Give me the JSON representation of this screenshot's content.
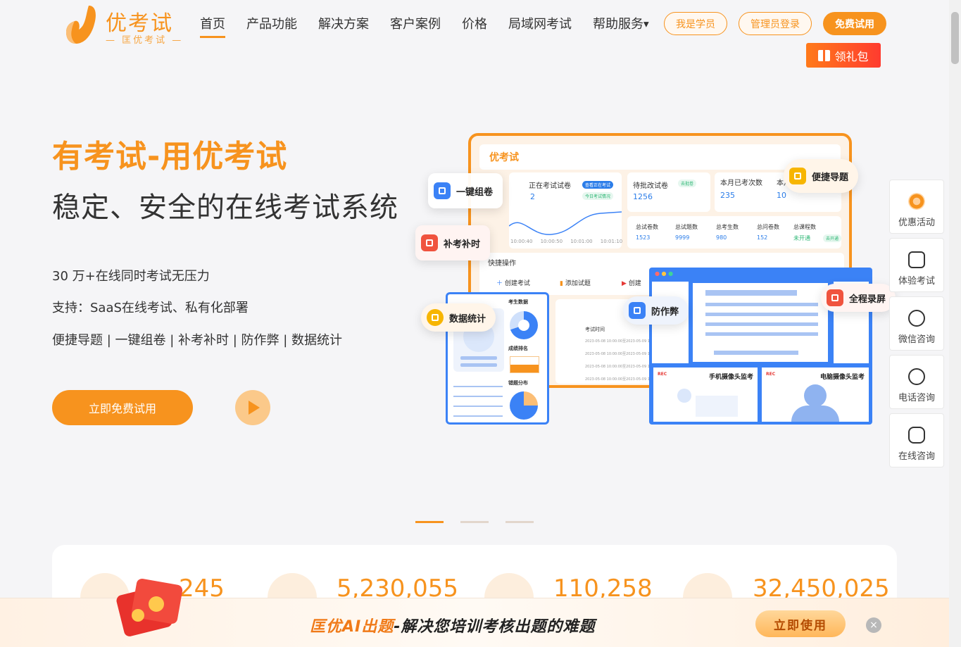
{
  "brand": {
    "name": "优考试",
    "sub": "— 匡优考试 —"
  },
  "nav": {
    "items": [
      "首页",
      "产品功能",
      "解决方案",
      "客户案例",
      "价格",
      "局域网考试",
      "帮助服务"
    ]
  },
  "header": {
    "student_btn": "我是学员",
    "admin_btn": "管理员登录",
    "free_btn": "免费试用",
    "gift_btn": "领礼包"
  },
  "hero": {
    "title": "有考试-用优考试",
    "subtitle": "稳定、安全的在线考试系统",
    "lines": [
      "30 万+在线同时考试无压力",
      "支持：SaaS在线考试、私有化部署",
      "便捷导题 | 一键组卷 | 补考补时 | 防作弊 | 数据统计"
    ],
    "cta": "立即免费试用"
  },
  "illustration": {
    "logo": "优考试",
    "cards": {
      "ongoing": {
        "label": "正在考试试卷",
        "value": "2",
        "badge": "查看正在考试",
        "badge2": "今日考试情况"
      },
      "pending": {
        "label": "待批改试卷",
        "value": "1256",
        "badge": "去批卷"
      },
      "monthly": {
        "label": "本月已考次数",
        "value": "235"
      },
      "monthly2": {
        "label": "本月",
        "value": "10"
      }
    },
    "times": [
      "10:00:40",
      "10:00:50",
      "10:01:00",
      "10:01:10"
    ],
    "stats": [
      {
        "label": "总试卷数",
        "value": "1523"
      },
      {
        "label": "总试题数",
        "value": "9999"
      },
      {
        "label": "总考生数",
        "value": "980"
      },
      {
        "label": "总问卷数",
        "value": "152"
      },
      {
        "label": "总课程数",
        "value": "未开通"
      }
    ],
    "stats_badge": "去开通",
    "quick": {
      "title": "快捷操作",
      "actions": [
        "创建考试",
        "添加试题",
        "创建"
      ]
    },
    "table_header": "考试时间",
    "table_rows": [
      "2023-05-08 10:00:00至2023-05-09 10:0",
      "2023-05-08 10:00:00至2023-05-09 10:0",
      "2023-05-08 10:00:00至2023-05-09 10:0",
      "2023-05-08 10:00:00至2023-05-09 10:0"
    ],
    "left_panel": {
      "a": "考生数据",
      "b": "成绩排名",
      "c": "错题分布"
    },
    "right_panel": {
      "cam1": "手机摄像头监考",
      "cam2": "电脑摄像头监考",
      "rec": "REC"
    },
    "tags": [
      "一键组卷",
      "便捷导题",
      "补考补时",
      "数据统计",
      "防作弊",
      "全程录屏"
    ]
  },
  "stats": [
    "245",
    "5,230,055",
    "110,258",
    "32,450,025"
  ],
  "side": [
    "优惠活动",
    "体验考试",
    "微信咨询",
    "电话咨询",
    "在线咨询"
  ],
  "banner": {
    "text_brand": "匡优AI出题",
    "text_rest": "-解决您培训考核出题的难题",
    "btn": "立即使用",
    "close": "×"
  },
  "colors": {
    "accent": "#f7931e",
    "blue": "#3b82f6"
  }
}
